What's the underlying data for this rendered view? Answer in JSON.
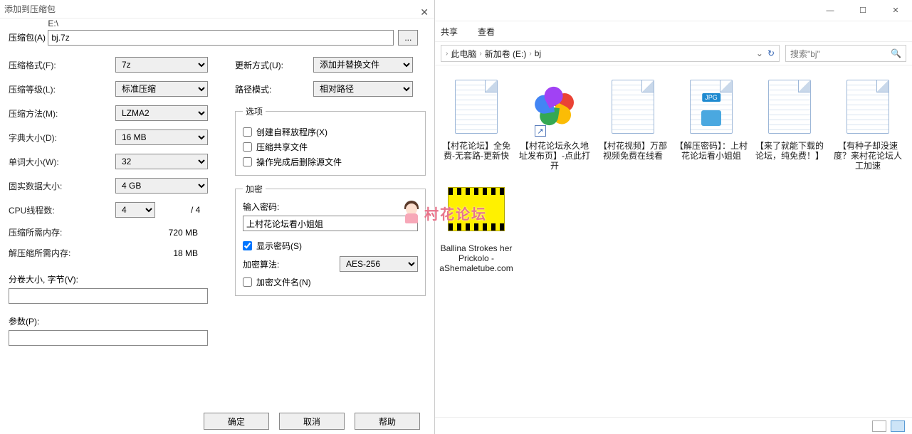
{
  "dialog": {
    "title": "添加到压缩包",
    "archive_label": "压缩包(A)",
    "path_hint": "E:\\",
    "archive_value": "bj.7z",
    "browse": "...",
    "format_label": "压缩格式(F):",
    "format_value": "7z",
    "level_label": "压缩等级(L):",
    "level_value": "标准压缩",
    "method_label": "压缩方法(M):",
    "method_value": "LZMA2",
    "dict_label": "字典大小(D):",
    "dict_value": "16 MB",
    "word_label": "单词大小(W):",
    "word_value": "32",
    "solid_label": "固实数据大小:",
    "solid_value": "4 GB",
    "threads_label": "CPU线程数:",
    "threads_value": "4",
    "threads_max": "/ 4",
    "mem_comp_label": "压缩所需内存:",
    "mem_comp_value": "720 MB",
    "mem_decomp_label": "解压缩所需内存:",
    "mem_decomp_value": "18 MB",
    "split_label": "分卷大小, 字节(V):",
    "params_label": "参数(P):",
    "update_label": "更新方式(U):",
    "update_value": "添加并替换文件",
    "pathmode_label": "路径模式:",
    "pathmode_value": "相对路径",
    "options_legend": "选项",
    "opt_sfx": "创建自释放程序(X)",
    "opt_shared": "压缩共享文件",
    "opt_delete": "操作完成后删除源文件",
    "enc_legend": "加密",
    "enc_pwd_label": "输入密码:",
    "enc_pwd_value": "上村花论坛看小姐姐",
    "enc_show": "显示密码(S)",
    "enc_algo_label": "加密算法:",
    "enc_algo_value": "AES-256",
    "enc_names": "加密文件名(N)",
    "ok": "确定",
    "cancel": "取消",
    "help": "帮助"
  },
  "explorer": {
    "menu_share": "共享",
    "menu_view": "查看",
    "crumb1": "此电脑",
    "crumb2": "新加卷 (E:)",
    "crumb3": "bj",
    "search_placeholder": "搜索\"bj\"",
    "files": [
      "【村花论坛】全免费-无套路-更新快",
      "【村花论坛永久地址发布页】-点此打开",
      "【村花视频】万部视频免费在线看",
      "【解压密码】：上村花论坛看小姐姐",
      "【来了就能下载的论坛，纯免费！】",
      "【有种子却没速度？来村花论坛人工加速",
      "Ballina Strokes her Prickolo - aShemaletube.com"
    ]
  },
  "watermark": "村花论坛"
}
